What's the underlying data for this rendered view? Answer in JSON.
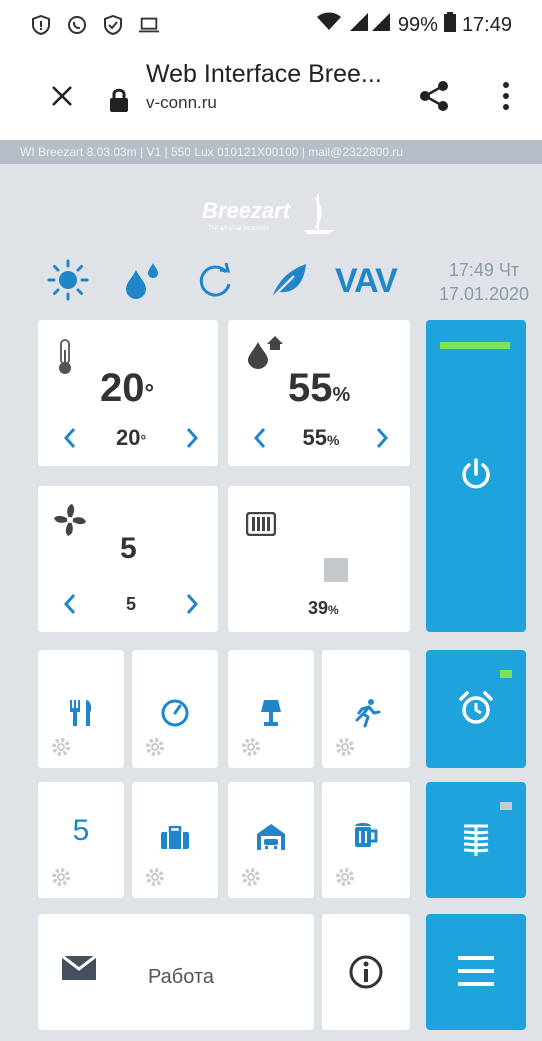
{
  "status_bar": {
    "battery_percent": "99%",
    "time": "17:49",
    "left_icons": [
      "alert-shield-icon",
      "do-not-disturb-icon",
      "vpn-shield-icon",
      "laptop-icon"
    ]
  },
  "browser": {
    "title": "Web Interface Bree...",
    "url": "v-conn.ru"
  },
  "info_strip": "WI Breezart 8.03.03m | V1 | 550 Lux 010121X00100 | mail@2322800.ru",
  "header": {
    "logo_text": "Breezart",
    "logo_tagline": "The art of air treatment",
    "modes": [
      "sun-icon",
      "humidity-icon",
      "recirculation-icon",
      "leaf-icon"
    ],
    "vav_label": "VAV",
    "clock": {
      "time": "17:49 Чт",
      "date": "17.01.2020"
    }
  },
  "temperature": {
    "current": "20",
    "unit": "°",
    "setpoint": "20",
    "setpoint_unit": "°"
  },
  "humidity": {
    "current": "55",
    "unit": "%",
    "setpoint": "55",
    "setpoint_unit": "%"
  },
  "fan": {
    "current": "5",
    "setpoint": "5"
  },
  "heater": {
    "percent": "39",
    "unit": "%"
  },
  "scenes_row1": [
    "fork-knife-icon",
    "timer-icon",
    "lamp-icon",
    "running-person-icon"
  ],
  "scenes_row2": {
    "number_tile": "5",
    "icons": [
      "briefcase-icon",
      "garage-icon",
      "beer-mug-icon"
    ]
  },
  "message": {
    "label": "Работа"
  },
  "colors": {
    "accent_blue": "#1ea3dd",
    "icon_blue": "#1f86c9",
    "active_green": "#7fe05a",
    "background": "#dfe3e7"
  }
}
